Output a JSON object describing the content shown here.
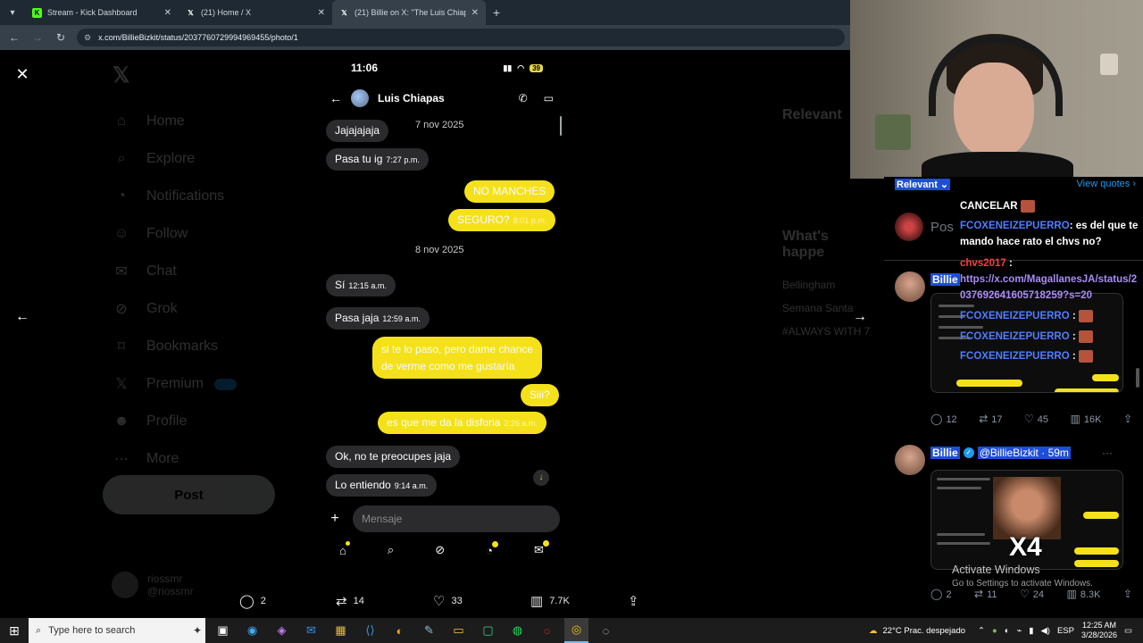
{
  "browser": {
    "tabs": [
      {
        "label": "Stream - Kick Dashboard",
        "favicon": "kick-icon"
      },
      {
        "label": "(21) Home / X",
        "favicon": "x-icon"
      },
      {
        "label": "(21) Billie on X: \"The Luis Chiap",
        "favicon": "x-icon"
      }
    ],
    "url": "x.com/BillieBizkit/status/2037760729994969455/photo/1"
  },
  "x_nav": {
    "items": [
      "Home",
      "Explore",
      "Notifications",
      "Follow",
      "Chat",
      "Grok",
      "Bookmarks",
      "Premium",
      "Profile",
      "More"
    ],
    "post_button": "Post",
    "account_name": "riossmr",
    "account_handle": "@riossmr"
  },
  "x_right": {
    "relevant": "Relevant",
    "whats_happening": "What's happe",
    "trends": [
      "Bellingham",
      "Semana Santa",
      "#ALWAYS WITH 7"
    ]
  },
  "phone": {
    "time": "11:06",
    "battery": "39",
    "contact": "Luis Chiapas",
    "messages": [
      {
        "dir": "in",
        "text": "Jajajajaja",
        "time": ""
      },
      {
        "dir": "date",
        "text": "7 nov 2025"
      },
      {
        "dir": "in",
        "text": "Pasa tu ig",
        "time": "7:27 p.m."
      },
      {
        "dir": "out",
        "text": "NO MANCHES",
        "time": ""
      },
      {
        "dir": "out",
        "text": "SEGURO?",
        "time": "8:01 p.m."
      },
      {
        "dir": "date",
        "text": "8 nov 2025"
      },
      {
        "dir": "in",
        "text": "Sí",
        "time": "12:15 a.m."
      },
      {
        "dir": "in",
        "text": "Pasa jaja",
        "time": "12:59 a.m."
      },
      {
        "dir": "out",
        "text": "si te lo paso, pero dame chance",
        "text2": "de verme como me gustaría",
        "time": ""
      },
      {
        "dir": "out",
        "text": "Siii?",
        "time": ""
      },
      {
        "dir": "out",
        "text": "es que me da la disforia",
        "time": "2:26 a.m."
      },
      {
        "dir": "in",
        "text": "Ok, no te preocupes jaja",
        "time": ""
      },
      {
        "dir": "in",
        "text": "Lo entiendo",
        "time": "9:14 a.m."
      }
    ],
    "input_placeholder": "Mensaje"
  },
  "post_actions": {
    "replies": "2",
    "reposts": "14",
    "likes": "33",
    "views": "7.7K"
  },
  "right_panel": {
    "sort": "Relevant",
    "view_quotes": "View quotes",
    "post_placeholder": "Pos",
    "reply1": {
      "name": "Billie",
      "stats": {
        "replies": "12",
        "reposts": "17",
        "likes": "45",
        "views": "16K"
      }
    },
    "reply2": {
      "name": "Billie",
      "handle": "@BillieBizkit",
      "age": "· 59m",
      "stats": {
        "replies": "2",
        "reposts": "11",
        "likes": "24",
        "views": "8.3K"
      }
    }
  },
  "chat": {
    "messages": [
      {
        "user": "",
        "text": "CANCELAR"
      },
      {
        "user": "FCOXENEIZEPUERRO",
        "text": ": es del que te mando hace rato el chvs no?"
      },
      {
        "user": "chvs2017",
        "text": " :"
      },
      {
        "user": "",
        "link": "https://x.com/MagallanesJA/status/2037692641605718259?s=20"
      },
      {
        "user": "FCOXENEIZEPUERRO",
        "text": " :"
      },
      {
        "user": "FCOXENEIZEPUERRO",
        "text": " :"
      },
      {
        "user": "FCOXENEIZEPUERRO",
        "text": " :"
      }
    ]
  },
  "overlay": {
    "x4": "X4",
    "activate_title": "Activate Windows",
    "activate_sub": "Go to Settings to activate Windows."
  },
  "taskbar": {
    "search_placeholder": "Type here to search",
    "weather": "22°C  Prac. despejado",
    "lang": "ESP",
    "time": "12:25 AM",
    "date": "3/28/2026"
  }
}
